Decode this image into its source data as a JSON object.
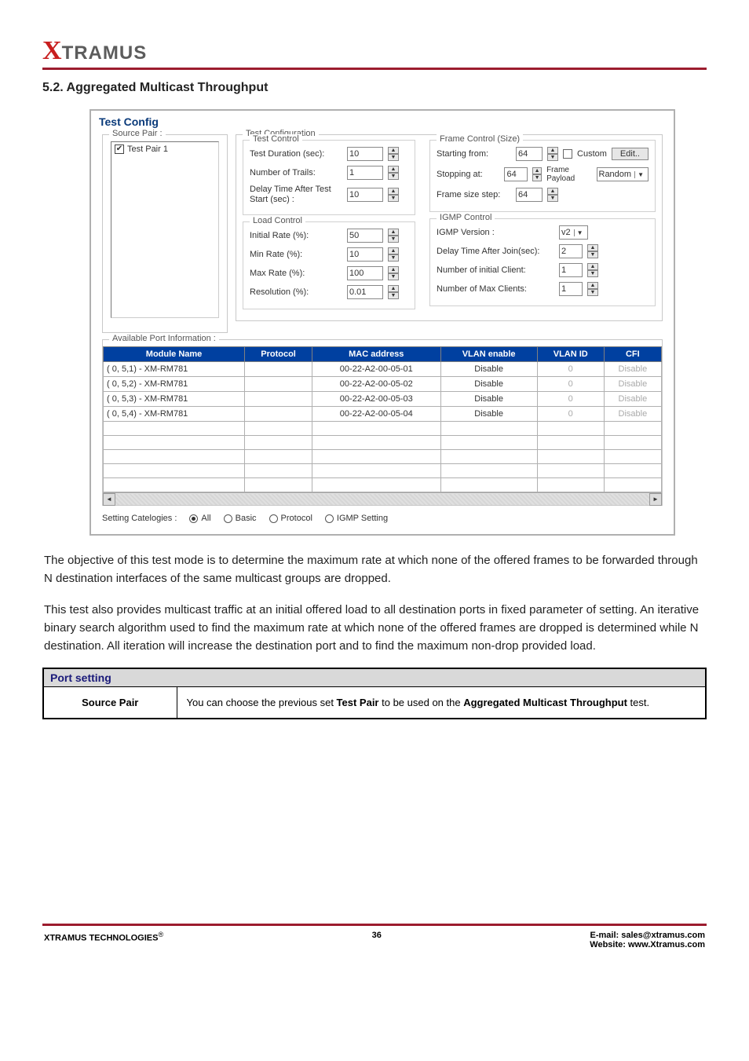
{
  "logo": {
    "x": "X",
    "rest": "TRAMUS"
  },
  "section_title": "5.2. Aggregated Multicast Throughput",
  "dialog": {
    "title": "Test Config",
    "source_pair": {
      "legend": "Source Pair :",
      "items": [
        "Test Pair 1"
      ]
    },
    "test_configuration_legend": "Test Configuration",
    "test_control": {
      "legend": "Test Control",
      "duration_label": "Test Duration (sec):",
      "duration_value": "10",
      "trails_label": "Number of Trails:",
      "trails_value": "1",
      "delay_label": "Delay Time After Test Start (sec) :",
      "delay_value": "10"
    },
    "load_control": {
      "legend": "Load Control",
      "initial_label": "Initial Rate (%):",
      "initial_value": "50",
      "min_label": "Min Rate (%):",
      "min_value": "10",
      "max_label": "Max Rate (%):",
      "max_value": "100",
      "res_label": "Resolution (%):",
      "res_value": "0.01"
    },
    "frame_control": {
      "legend": "Frame Control (Size)",
      "start_label": "Starting from:",
      "start_value": "64",
      "stop_label": "Stopping at:",
      "stop_value": "64",
      "step_label": "Frame size step:",
      "step_value": "64",
      "custom_label": "Custom",
      "edit_label": "Edit..",
      "payload_label": "Frame Payload",
      "payload_value": "Random"
    },
    "igmp_control": {
      "legend": "IGMP Control",
      "version_label": "IGMP Version :",
      "version_value": "v2",
      "delay_label": "Delay Time After Join(sec):",
      "delay_value": "2",
      "initclient_label": "Number of initial Client:",
      "initclient_value": "1",
      "maxclient_label": "Number of Max Clients:",
      "maxclient_value": "1"
    },
    "port_info": {
      "legend": "Available Port Information :",
      "headers": [
        "Module Name",
        "Protocol",
        "MAC address",
        "VLAN enable",
        "VLAN ID",
        "CFI"
      ],
      "rows": [
        {
          "name": "( 0, 5,1) - XM-RM781",
          "protocol": "",
          "mac": "00-22-A2-00-05-01",
          "vlan": "Disable",
          "vlanid": "0",
          "cfi": "Disable"
        },
        {
          "name": "( 0, 5,2) - XM-RM781",
          "protocol": "",
          "mac": "00-22-A2-00-05-02",
          "vlan": "Disable",
          "vlanid": "0",
          "cfi": "Disable"
        },
        {
          "name": "( 0, 5,3) - XM-RM781",
          "protocol": "",
          "mac": "00-22-A2-00-05-03",
          "vlan": "Disable",
          "vlanid": "0",
          "cfi": "Disable"
        },
        {
          "name": "( 0, 5,4) - XM-RM781",
          "protocol": "",
          "mac": "00-22-A2-00-05-04",
          "vlan": "Disable",
          "vlanid": "0",
          "cfi": "Disable"
        }
      ]
    },
    "categories": {
      "label": "Setting Catelogies :",
      "all": "All",
      "basic": "Basic",
      "protocol": "Protocol",
      "igmp": "IGMP Setting"
    }
  },
  "body": {
    "p1": "The objective of this test mode is to determine the maximum rate at which none of the offered frames to be forwarded through N destination interfaces of the same multicast groups are dropped.",
    "p2": "This test also provides multicast traffic at an initial offered load to all destination ports in fixed parameter of setting. An iterative binary search algorithm used to find the maximum rate at which none of the offered frames are dropped is determined while N destination. All iteration will increase the destination port and to find the maximum non-drop provided load."
  },
  "port_setting": {
    "header": "Port setting",
    "row_label": "Source Pair",
    "row_text_a": "You can choose the previous set ",
    "row_text_b": "Test Pair",
    "row_text_c": " to be used on the ",
    "row_text_d": "Aggregated Multicast Throughput",
    "row_text_e": " test."
  },
  "footer": {
    "left_a": "XTRAMUS TECHNOLOGIES",
    "left_sup": "®",
    "page": "36",
    "email_l": "E-mail: ",
    "email_v": "sales@xtramus.com",
    "web_l": "Website:  ",
    "web_v": "www.Xtramus.com"
  }
}
